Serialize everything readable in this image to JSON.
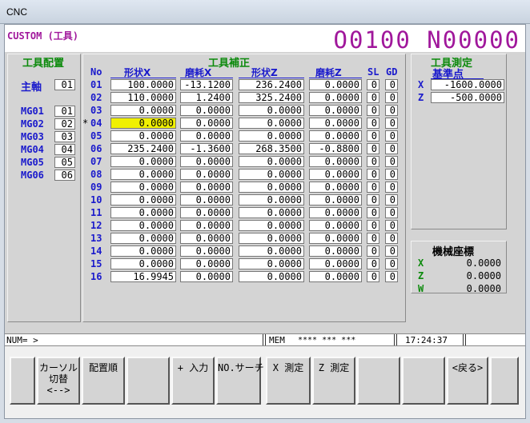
{
  "window": {
    "title": "CNC"
  },
  "header": {
    "screen_name": "CUSTOM (工具)",
    "program_number": "O0100 N00000"
  },
  "tool_layout": {
    "title": "工具配置",
    "spindle_label": "主軸",
    "spindle_value": "01",
    "magazines": [
      {
        "label": "MG01",
        "value": "01"
      },
      {
        "label": "MG02",
        "value": "02"
      },
      {
        "label": "MG03",
        "value": "03"
      },
      {
        "label": "MG04",
        "value": "04"
      },
      {
        "label": "MG05",
        "value": "05"
      },
      {
        "label": "MG06",
        "value": "06"
      }
    ]
  },
  "offsets": {
    "title": "工具補正",
    "columns": {
      "no": "No",
      "geom_x": "形状X",
      "wear_x": "磨耗X",
      "geom_z": "形状Z",
      "wear_z": "磨耗Z",
      "sl": "SL",
      "gd": "GD"
    },
    "current_row": "04",
    "rows": [
      {
        "no": "01",
        "geom_x": "100.0000",
        "wear_x": "-13.1200",
        "geom_z": "236.2400",
        "wear_z": "0.0000",
        "sl": "0",
        "gd": "0"
      },
      {
        "no": "02",
        "geom_x": "110.0000",
        "wear_x": "1.2400",
        "geom_z": "325.2400",
        "wear_z": "0.0000",
        "sl": "0",
        "gd": "0"
      },
      {
        "no": "03",
        "geom_x": "0.0000",
        "wear_x": "0.0000",
        "geom_z": "0.0000",
        "wear_z": "0.0000",
        "sl": "0",
        "gd": "0"
      },
      {
        "no": "04",
        "geom_x": "0.0000",
        "wear_x": "0.0000",
        "geom_z": "0.0000",
        "wear_z": "0.0000",
        "sl": "0",
        "gd": "0"
      },
      {
        "no": "05",
        "geom_x": "0.0000",
        "wear_x": "0.0000",
        "geom_z": "0.0000",
        "wear_z": "0.0000",
        "sl": "0",
        "gd": "0"
      },
      {
        "no": "06",
        "geom_x": "235.2400",
        "wear_x": "-1.3600",
        "geom_z": "268.3500",
        "wear_z": "-0.8800",
        "sl": "0",
        "gd": "0"
      },
      {
        "no": "07",
        "geom_x": "0.0000",
        "wear_x": "0.0000",
        "geom_z": "0.0000",
        "wear_z": "0.0000",
        "sl": "0",
        "gd": "0"
      },
      {
        "no": "08",
        "geom_x": "0.0000",
        "wear_x": "0.0000",
        "geom_z": "0.0000",
        "wear_z": "0.0000",
        "sl": "0",
        "gd": "0"
      },
      {
        "no": "09",
        "geom_x": "0.0000",
        "wear_x": "0.0000",
        "geom_z": "0.0000",
        "wear_z": "0.0000",
        "sl": "0",
        "gd": "0"
      },
      {
        "no": "10",
        "geom_x": "0.0000",
        "wear_x": "0.0000",
        "geom_z": "0.0000",
        "wear_z": "0.0000",
        "sl": "0",
        "gd": "0"
      },
      {
        "no": "11",
        "geom_x": "0.0000",
        "wear_x": "0.0000",
        "geom_z": "0.0000",
        "wear_z": "0.0000",
        "sl": "0",
        "gd": "0"
      },
      {
        "no": "12",
        "geom_x": "0.0000",
        "wear_x": "0.0000",
        "geom_z": "0.0000",
        "wear_z": "0.0000",
        "sl": "0",
        "gd": "0"
      },
      {
        "no": "13",
        "geom_x": "0.0000",
        "wear_x": "0.0000",
        "geom_z": "0.0000",
        "wear_z": "0.0000",
        "sl": "0",
        "gd": "0"
      },
      {
        "no": "14",
        "geom_x": "0.0000",
        "wear_x": "0.0000",
        "geom_z": "0.0000",
        "wear_z": "0.0000",
        "sl": "0",
        "gd": "0"
      },
      {
        "no": "15",
        "geom_x": "0.0000",
        "wear_x": "0.0000",
        "geom_z": "0.0000",
        "wear_z": "0.0000",
        "sl": "0",
        "gd": "0"
      },
      {
        "no": "16",
        "geom_x": "16.9945",
        "wear_x": "0.0000",
        "geom_z": "0.0000",
        "wear_z": "0.0000",
        "sl": "0",
        "gd": "0"
      }
    ]
  },
  "tool_measure": {
    "title": "工具測定",
    "ref_title": "基準点",
    "ref": [
      {
        "axis": "X",
        "value": "-1600.0000"
      },
      {
        "axis": "Z",
        "value": "-500.0000"
      }
    ]
  },
  "machine_coords": {
    "title": "機械座標",
    "rows": [
      {
        "axis": "X",
        "value": "0.0000"
      },
      {
        "axis": "Z",
        "value": "0.0000"
      },
      {
        "axis": "W",
        "value": "0.0000"
      }
    ]
  },
  "status_bar": {
    "input": "NUM= >",
    "mode": "MEM",
    "state": "**** *** ***",
    "time": "17:24:37"
  },
  "softkeys": [
    {
      "label": ""
    },
    {
      "label": "カーソル\n切替\n<-->"
    },
    {
      "label": "配置順"
    },
    {
      "label": ""
    },
    {
      "label": "+ 入力"
    },
    {
      "label": "NO.サーチ"
    },
    {
      "label": "X 測定"
    },
    {
      "label": "Z 測定"
    },
    {
      "label": ""
    },
    {
      "label": ""
    },
    {
      "label": "<戻る>"
    },
    {
      "label": ""
    }
  ],
  "colors": {
    "magenta": "#a0179b",
    "green": "#0c8a0c",
    "blue": "#1a1acc",
    "highlight": "#f0f000",
    "panel": "#d4d4d4"
  }
}
